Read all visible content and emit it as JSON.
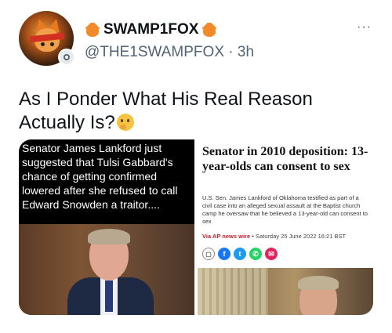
{
  "author": {
    "display_name": "SWAMP1FOX",
    "handle": "@THE1SWAMPFOX",
    "separator": "·",
    "time": "3h",
    "name_emoji": "fox-face-icon"
  },
  "more_menu": "···",
  "tweet": {
    "text": "As I Ponder What His Real Reason Actually Is?",
    "emoji": "thinking-face-icon"
  },
  "media": {
    "left": {
      "caption": "Senator James Lankford just suggested that Tulsi Gabbard's chance of getting confirmed lowered after she refused to call Edward Snowden a traitor...."
    },
    "right": {
      "headline": "Senator in 2010 deposition: 13-year-olds can consent to sex",
      "body": "U.S. Sen. James Lankford of Oklahoma testified as part of a civil case into an alleged sexual assault at the Baptist church camp he oversaw that he believed a 13-year-old can consent to sex",
      "source": "Via AP news wire",
      "bullet": "•",
      "date": "Saturday 25 June 2022 16:21 BST",
      "share_icons": [
        "bookmark-icon",
        "facebook-icon",
        "twitter-icon",
        "whatsapp-icon",
        "email-icon"
      ]
    }
  },
  "colors": {
    "text": "#0f1419",
    "secondary": "#536471",
    "source_red": "#c0202a"
  }
}
